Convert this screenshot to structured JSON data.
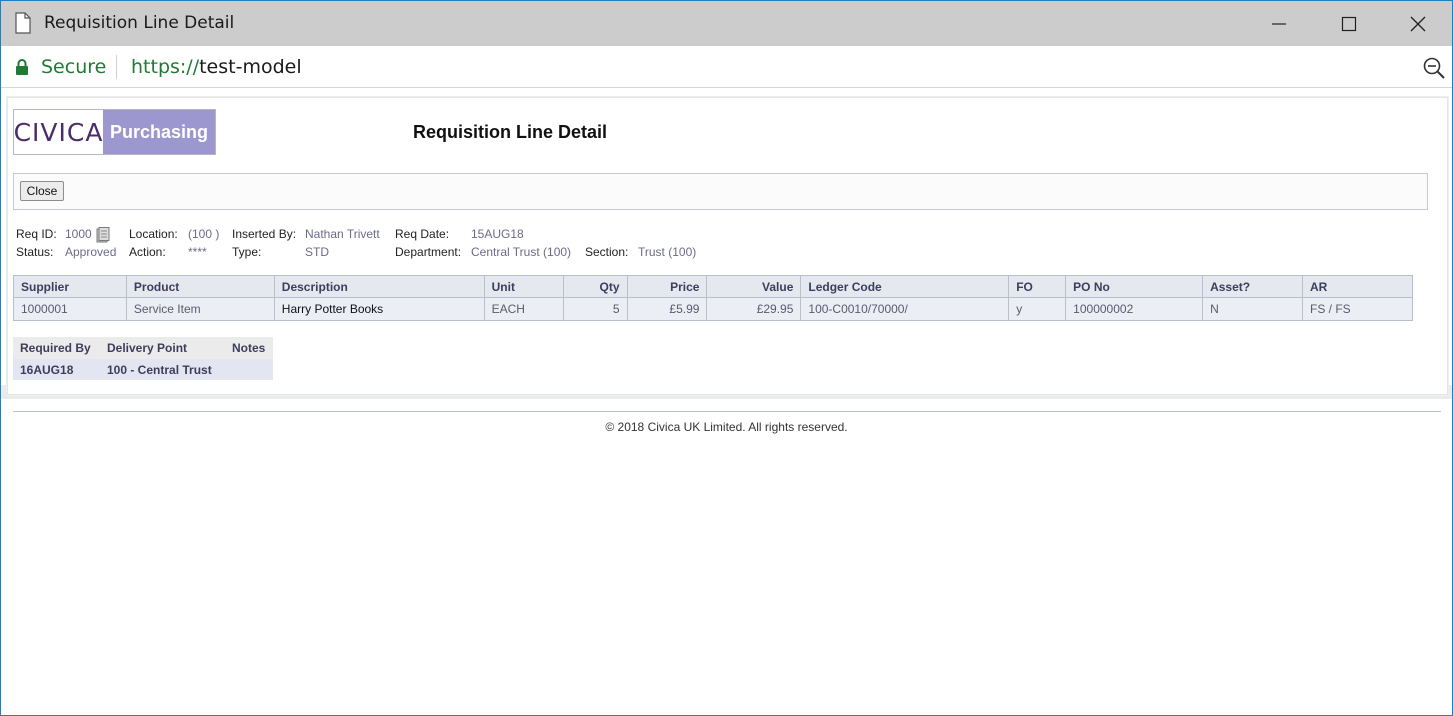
{
  "window": {
    "title": "Requisition Line Detail",
    "minimize_icon": "minimize-icon",
    "maximize_icon": "maximize-icon",
    "close_icon": "close-icon"
  },
  "addressbar": {
    "secure_label": "Secure",
    "url_scheme": "https://",
    "url_host": "test-model"
  },
  "logo": {
    "brand": "CIVICA",
    "product": "Purchasing"
  },
  "page": {
    "title": "Requisition Line Detail"
  },
  "toolbar": {
    "close_label": "Close"
  },
  "header": {
    "req_id_label": "Req ID:",
    "req_id": "1000",
    "status_label": "Status:",
    "status": "Approved",
    "location_label": "Location:",
    "location": "(100 )",
    "action_label": "Action:",
    "action": "****",
    "inserted_by_label": "Inserted By:",
    "inserted_by": "Nathan Trivett",
    "type_label": "Type:",
    "type": "STD",
    "req_date_label": "Req Date:",
    "req_date": "15AUG18",
    "department_label": "Department:",
    "department": "Central Trust (100)",
    "section_label": "Section:",
    "section": "Trust (100)"
  },
  "lines_table": {
    "columns": [
      "Supplier",
      "Product",
      "Description",
      "Unit",
      "Qty",
      "Price",
      "Value",
      "Ledger Code",
      "FO",
      "PO No",
      "Asset?",
      "AR"
    ],
    "rows": [
      [
        "1000001",
        "Service Item",
        "Harry Potter Books",
        "EACH",
        "5",
        "£5.99",
        "£29.95",
        "100-C0010/70000/",
        "y",
        "100000002",
        "N",
        "FS / FS"
      ]
    ]
  },
  "delivery_table": {
    "columns": [
      "Required By",
      "Delivery Point",
      "Notes"
    ],
    "rows": [
      [
        "16AUG18",
        "100 - Central Trust",
        ""
      ]
    ]
  },
  "footer": {
    "copyright": "© 2018 Civica UK Limited. All rights reserved."
  },
  "colors": {
    "titlebar": "#cccccc",
    "secure_green": "#1e7b34",
    "logo_purple": "#9c98cf",
    "brand_text": "#4b2c6b"
  }
}
